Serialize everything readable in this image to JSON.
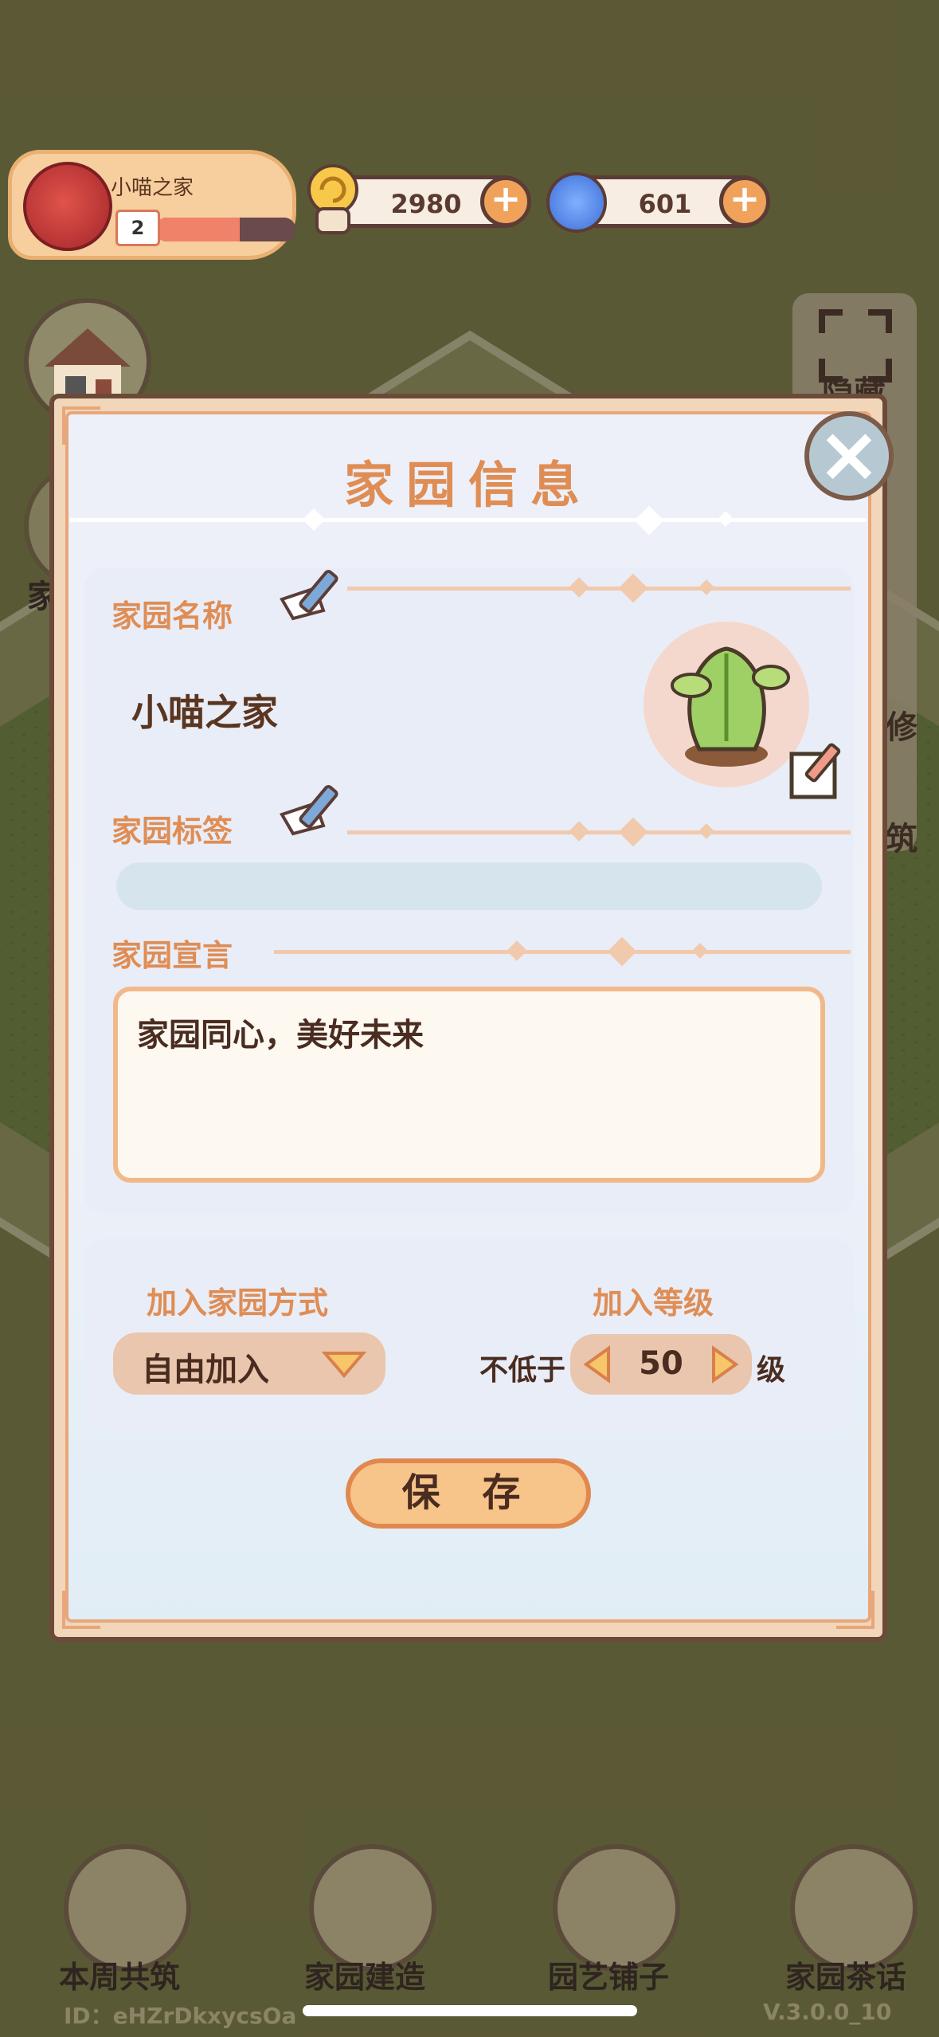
{
  "hud": {
    "home_name": "小喵之家",
    "home_level": "2",
    "level_progress": 0.6,
    "coins": "2980",
    "gems": "601"
  },
  "side": {
    "right_top": "隐藏",
    "right_mid1": "修",
    "right_mid2": "筑",
    "left_char": "家"
  },
  "modal": {
    "title": "家园信息",
    "name_label": "家园名称",
    "name_value": "小喵之家",
    "tag_label": "家园标签",
    "tag_value": "",
    "manifesto_label": "家园宣言",
    "manifesto_value": "家园同心，美好未来",
    "join_method_label": "加入家园方式",
    "join_method_value": "自由加入",
    "join_level_label": "加入等级",
    "level_prefix": "不低于",
    "level_value": "50",
    "level_suffix": "级",
    "save_label": "保 存"
  },
  "nav": [
    {
      "label": "本周共筑"
    },
    {
      "label": "家园建造"
    },
    {
      "label": "园艺铺子"
    },
    {
      "label": "家园茶话"
    }
  ],
  "footer": {
    "id": "ID：eHZrDkxycsOa",
    "version": "V.3.0.0_10"
  },
  "colors": {
    "accent": "#df8d55",
    "modal_bg": "#eef0f9",
    "border": "#e7a77a"
  }
}
